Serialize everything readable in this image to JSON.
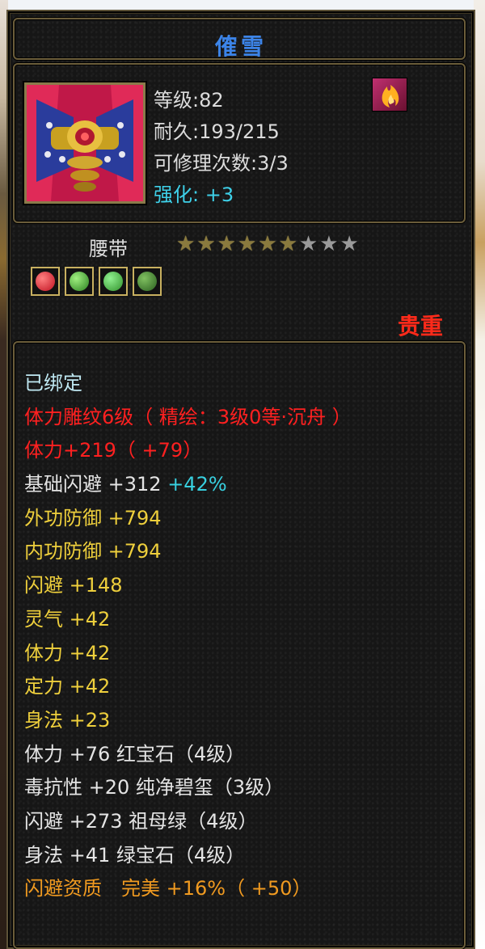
{
  "item": {
    "name": "傕雪",
    "level_line": "等级:82",
    "durability_line": "耐久:193/215",
    "repair_line": "可修理次数:3/3",
    "enhance_line": "强化: +3",
    "type": "腰带",
    "rarity": "贵重",
    "stars_filled": 6,
    "stars_total": 9,
    "gem_colors": [
      "#e02030",
      "#3aa030",
      "#48b040",
      "#3a8a30"
    ],
    "icons": {
      "item": "belt-icon",
      "special": "flame-icon"
    }
  },
  "details": {
    "bound": "已绑定",
    "engrave": "体力雕纹6级（ 精绘：3级0等·沉舟 ）",
    "stamina_base": "体力+219（ +79）",
    "dodge_base": "基础闪避 +312",
    "dodge_base_pct": "+42%",
    "ext_def": "外功防御 +794",
    "int_def": "内功防御 +794",
    "dodge": "闪避 +148",
    "spirit": "灵气 +42",
    "stamina": "体力 +42",
    "focus": "定力 +42",
    "agility": "身法 +23",
    "gem1": "体力 +76 红宝石（4级）",
    "gem2": "毒抗性 +20 纯净碧玺（3级）",
    "gem3": "闪避 +273 祖母绿（4级）",
    "gem4": "身法 +41 绿宝石（4级）",
    "aptitude": "闪避资质　完美 +16%（ +50）"
  },
  "colors": {
    "title": "#3c84e8",
    "red": "#ff2020",
    "gold": "#eecf3c",
    "orange": "#f09a20",
    "cyan": "#38d0e0"
  }
}
